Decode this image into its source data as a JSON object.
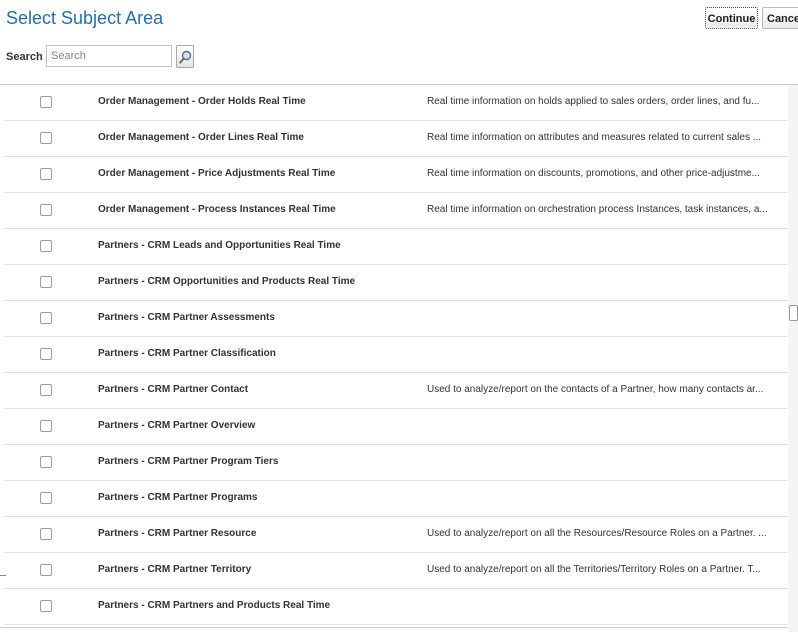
{
  "dialog": {
    "title": "Select Subject Area",
    "continue_label": "Continue",
    "cancel_label": "Cance"
  },
  "search": {
    "label": "Search",
    "placeholder": "Search",
    "value": ""
  },
  "rows": [
    {
      "name": "Order Management - Order Holds Real Time",
      "description": "Real time information on holds applied to sales orders, order lines, and fu...",
      "checked": false
    },
    {
      "name": "Order Management - Order Lines Real Time",
      "description": "Real time information on attributes and measures related to current sales ...",
      "checked": false
    },
    {
      "name": "Order Management - Price Adjustments Real Time",
      "description": "Real time information on discounts, promotions, and other price-adjustme...",
      "checked": false
    },
    {
      "name": "Order Management - Process Instances Real Time",
      "description": "Real time information on orchestration process Instances, task instances, a...",
      "checked": false
    },
    {
      "name": "Partners - CRM Leads and Opportunities Real Time",
      "description": "",
      "checked": false
    },
    {
      "name": "Partners - CRM Opportunities and Products Real Time",
      "description": "",
      "checked": false
    },
    {
      "name": "Partners - CRM Partner Assessments",
      "description": "",
      "checked": false
    },
    {
      "name": "Partners - CRM Partner Classification",
      "description": "",
      "checked": false
    },
    {
      "name": "Partners - CRM Partner Contact",
      "description": "Used to analyze/report on the contacts of a Partner, how many contacts ar...",
      "checked": false
    },
    {
      "name": "Partners - CRM Partner Overview",
      "description": "",
      "checked": false
    },
    {
      "name": "Partners - CRM Partner Program Tiers",
      "description": "",
      "checked": false
    },
    {
      "name": "Partners - CRM Partner Programs",
      "description": "",
      "checked": false
    },
    {
      "name": "Partners - CRM Partner Resource",
      "description": "Used to analyze/report on all the Resources/Resource Roles on a Partner. ...",
      "checked": false
    },
    {
      "name": "Partners - CRM Partner Territory",
      "description": "Used to analyze/report on all the Territories/Territory Roles on a Partner. T...",
      "checked": false
    },
    {
      "name": "Partners - CRM Partners and Products Real Time",
      "description": "",
      "checked": false
    }
  ],
  "colors": {
    "title": "#1f6fb5",
    "text": "#333333",
    "row_divider": "#e3e3e3"
  },
  "icons": {
    "search_button": "magnifier-icon",
    "row_select": "checkbox-icon"
  }
}
